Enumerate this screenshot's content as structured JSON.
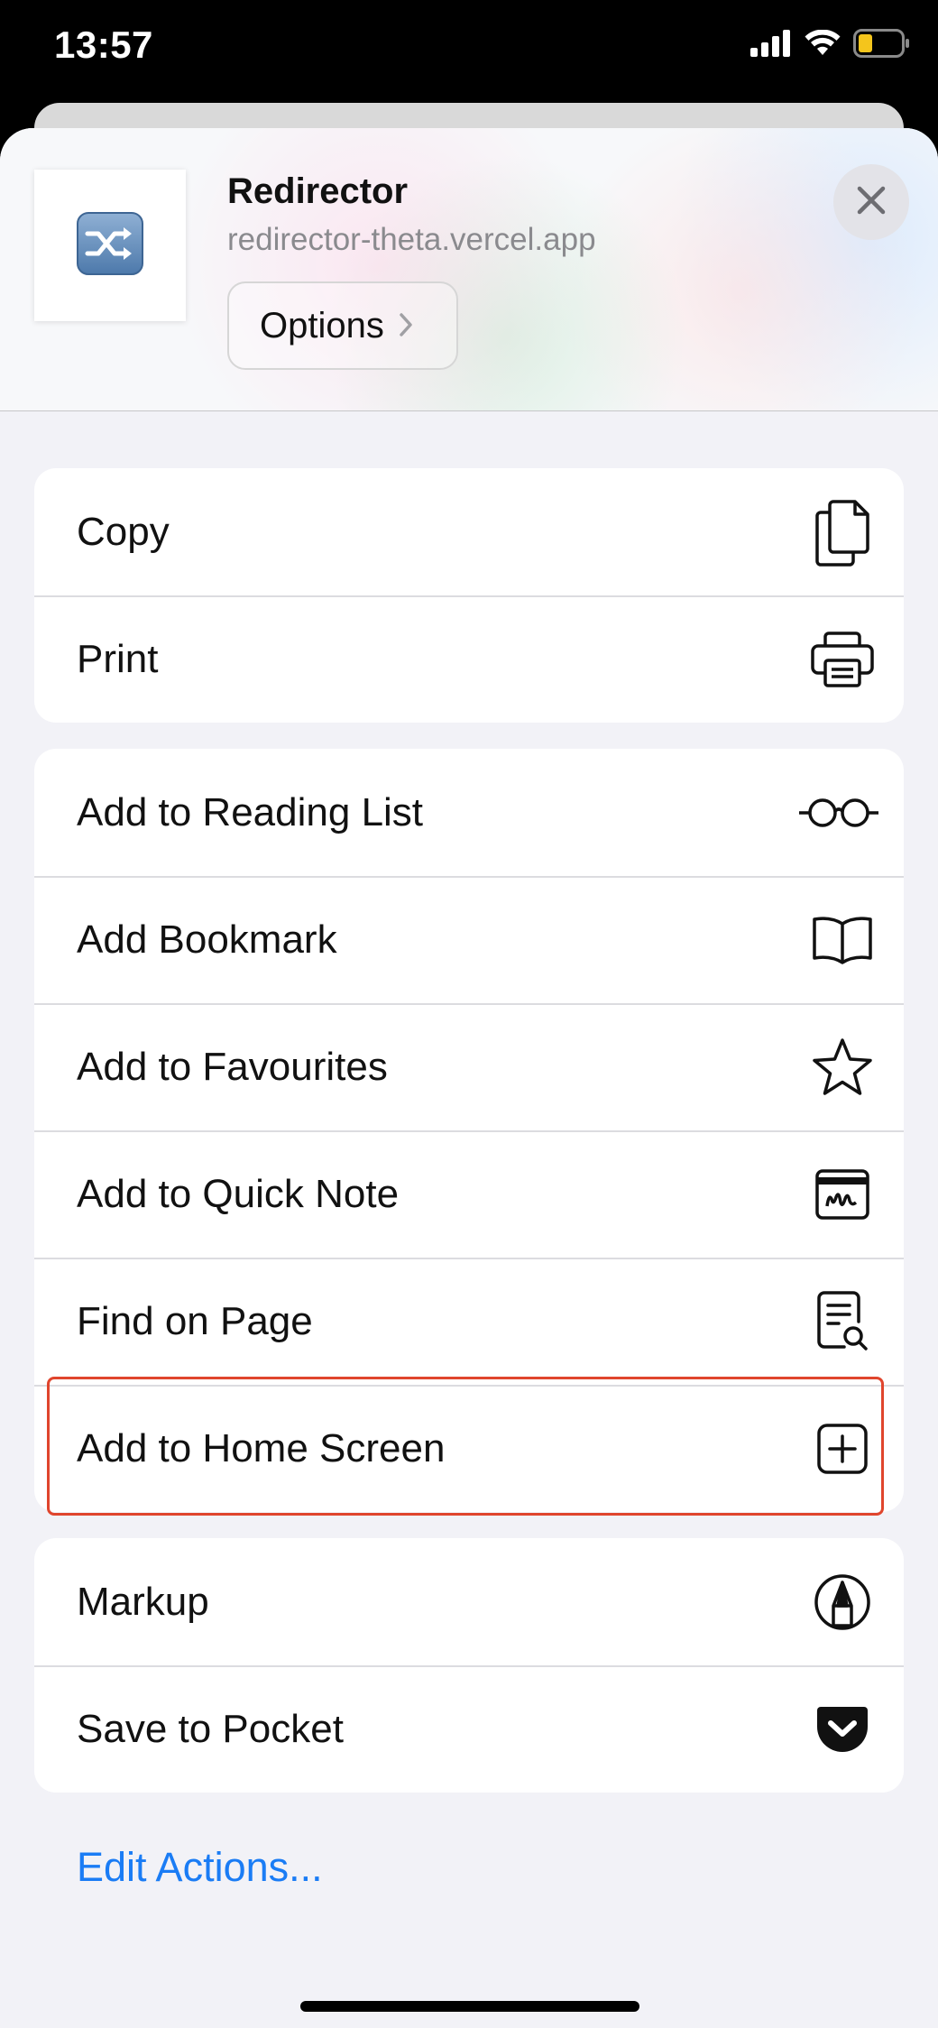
{
  "status_bar": {
    "time": "13:57"
  },
  "header": {
    "title": "Redirector",
    "url": "redirector-theta.vercel.app",
    "options_label": "Options",
    "favicon": "shuffle-icon"
  },
  "groups": [
    {
      "items": [
        {
          "label": "Copy",
          "icon": "copy-icon"
        },
        {
          "label": "Print",
          "icon": "printer-icon"
        }
      ]
    },
    {
      "items": [
        {
          "label": "Add to Reading List",
          "icon": "glasses-icon"
        },
        {
          "label": "Add Bookmark",
          "icon": "book-icon"
        },
        {
          "label": "Add to Favourites",
          "icon": "star-icon"
        },
        {
          "label": "Add to Quick Note",
          "icon": "quick-note-icon"
        },
        {
          "label": "Find on Page",
          "icon": "find-document-icon"
        },
        {
          "label": "Add to Home Screen",
          "icon": "plus-square-icon"
        }
      ]
    },
    {
      "items": [
        {
          "label": "Markup",
          "icon": "markup-pen-icon"
        },
        {
          "label": "Save to Pocket",
          "icon": "pocket-icon"
        }
      ]
    }
  ],
  "edit_actions_label": "Edit Actions...",
  "highlight_color": "#e0452d",
  "accent_color": "#1a7cf5"
}
